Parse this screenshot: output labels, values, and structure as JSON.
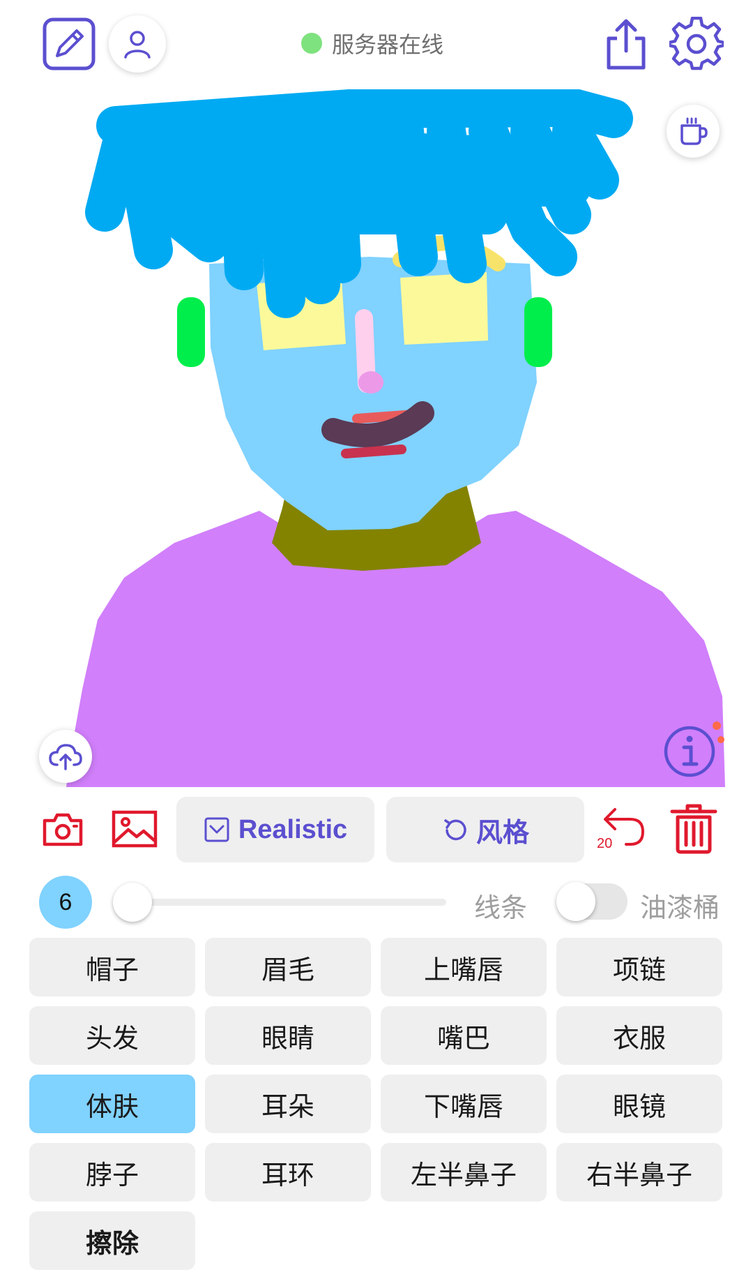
{
  "header": {
    "status_text": "服务器在线",
    "status_color": "#7ee27e",
    "accent_color": "#5b4fd0",
    "left_icons": [
      "edit-icon",
      "user-icon"
    ],
    "right_icons": [
      "share-icon",
      "settings-icon"
    ]
  },
  "canvas": {
    "coffee_icon": "coffee-icon",
    "upload_icon": "cloud-upload-icon",
    "info_icon": "info-icon"
  },
  "toolbar": {
    "camera_icon": "camera-icon",
    "gallery_icon": "image-icon",
    "model_label": "Realistic",
    "style_label": "风格",
    "undo_count": "20",
    "delete_icon": "trash-icon",
    "danger_color": "#e0192d"
  },
  "stroke": {
    "size": "6",
    "size_slider_fraction": 0.0,
    "line_label": "线条",
    "bucket_label": "油漆桶",
    "bucket_enabled": false
  },
  "parts": {
    "selected": "体肤",
    "items": [
      "帽子",
      "眉毛",
      "上嘴唇",
      "项链",
      "头发",
      "眼睛",
      "嘴巴",
      "衣服",
      "体肤",
      "耳朵",
      "下嘴唇",
      "眼镜",
      "脖子",
      "耳环",
      "左半鼻子",
      "右半鼻子",
      "擦除"
    ]
  }
}
